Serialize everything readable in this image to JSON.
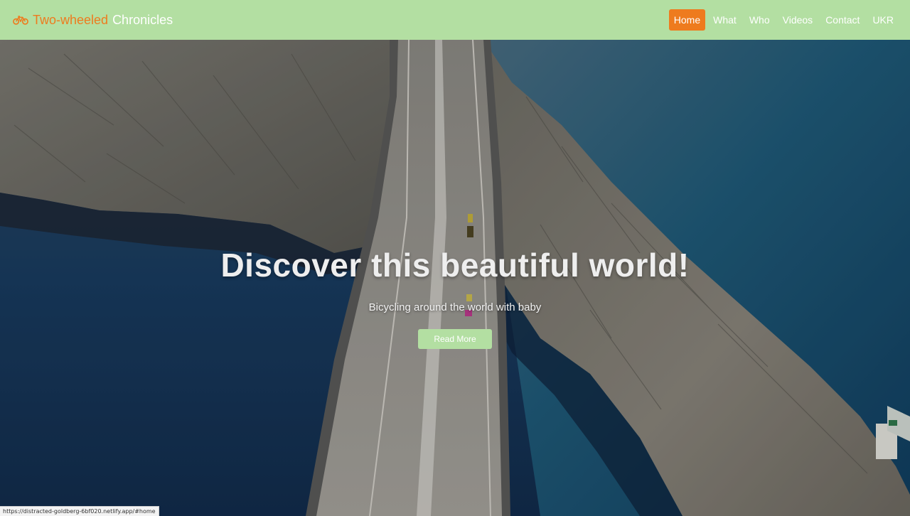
{
  "brand": {
    "accent": "Two-wheeled",
    "rest": "Chronicles",
    "icon": "bicycle-icon",
    "accent_color": "#ee7b1e"
  },
  "nav": {
    "items": [
      {
        "label": "Home",
        "active": true
      },
      {
        "label": "What",
        "active": false
      },
      {
        "label": "Who",
        "active": false
      },
      {
        "label": "Videos",
        "active": false
      },
      {
        "label": "Contact",
        "active": false
      },
      {
        "label": "UKR",
        "active": false
      }
    ],
    "background_color": "#b3dfa2",
    "active_color": "#ee7b1e"
  },
  "hero": {
    "title": "Discover this beautiful world!",
    "subtitle": "Bicycling around the world with baby",
    "button_label": "Read More",
    "image": "aerial-bridge-over-sea-photo"
  },
  "status_bar": {
    "url": "https://distracted-goldberg-6bf020.netlify.app/#home"
  }
}
